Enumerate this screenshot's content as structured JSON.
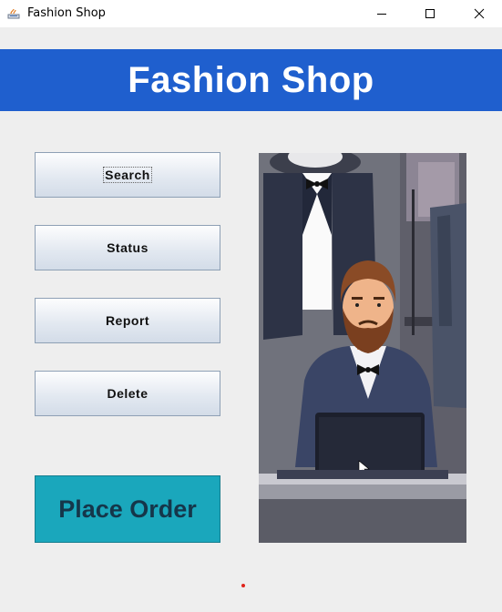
{
  "window": {
    "title": "Fashion Shop"
  },
  "banner": {
    "title": "Fashion Shop",
    "color": "#1f5fce"
  },
  "menu": {
    "search_label": "Search",
    "status_label": "Status",
    "report_label": "Report",
    "delete_label": "Delete"
  },
  "order": {
    "label": "Place Order",
    "color": "#1aa7bc"
  }
}
